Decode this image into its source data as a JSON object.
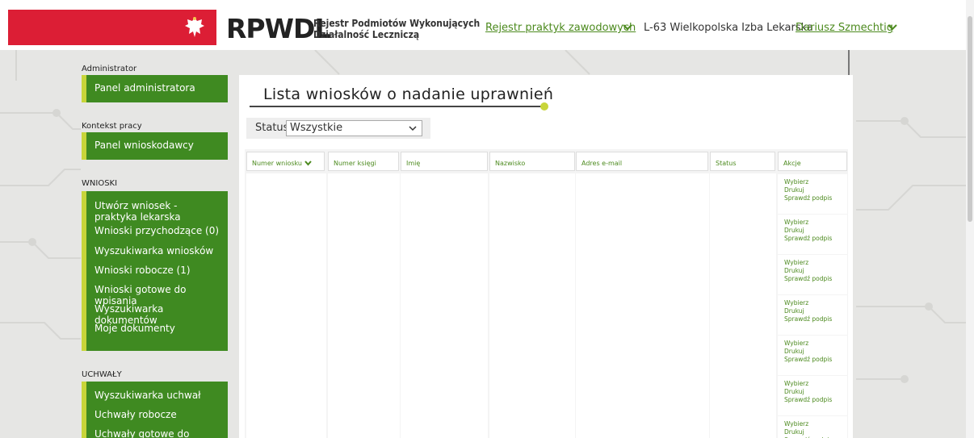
{
  "header": {
    "logo": "RPWDL",
    "subtitle_line1": "Rejestr Podmiotów Wykonujących",
    "subtitle_line2": "Działalność Leczniczą",
    "register_link": "Rejestr praktyk zawodowych",
    "chamber": "L-63 Wielkopolska Izba Lekarska",
    "user_link": "Dariusz Szmechtig"
  },
  "sidebar": {
    "sections": [
      {
        "label": "Administrator",
        "items": [
          "Panel administratora"
        ]
      },
      {
        "label": "Kontekst pracy",
        "items": [
          "Panel wnioskodawcy"
        ]
      },
      {
        "label": "WNIOSKI",
        "items": [
          "Utwórz wniosek - praktyka lekarska",
          "Wnioski przychodzące (0)",
          "Wyszukiwarka wniosków",
          "Wnioski robocze (1)",
          "Wnioski gotowe do wpisania",
          "Wyszukiwarka dokumentów",
          "Moje dokumenty"
        ]
      },
      {
        "label": "UCHWAŁY",
        "items": [
          "Wyszukiwarka uchwał",
          "Uchwały robocze",
          "Uchwały gotowe do wpisania"
        ]
      }
    ]
  },
  "main": {
    "title": "Lista wniosków o nadanie uprawnień",
    "filter_label": "Status",
    "filter_value": "Wszystkie",
    "columns": [
      "Numer wniosku",
      "Numer księgi",
      "Imię",
      "Nazwisko",
      "Adres e-mail",
      "Status",
      "Akcje"
    ],
    "actions": [
      "Wybierz",
      "Drukuj",
      "Sprawdź podpis"
    ],
    "row_count": 7
  },
  "colors": {
    "brand_green": "#3f8a21",
    "accent_yellow": "#c8d53a",
    "header_red": "#dc1e35",
    "link_green": "#4c8a1e"
  }
}
